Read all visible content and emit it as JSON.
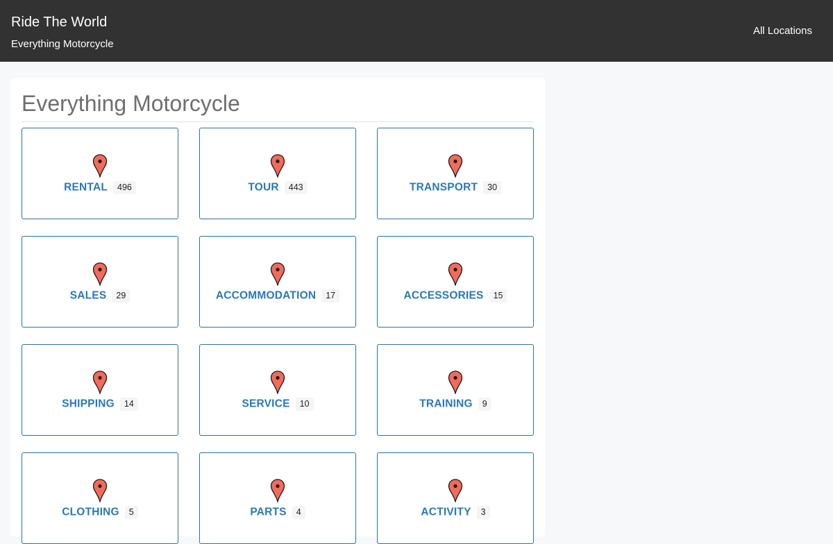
{
  "header": {
    "brand_title": "Ride The World",
    "brand_subtitle": "Everything Motorcycle",
    "nav_link": "All Locations"
  },
  "main": {
    "title": "Everything Motorcycle",
    "categories": [
      {
        "label": "RENTAL",
        "count": "496"
      },
      {
        "label": "TOUR",
        "count": "443"
      },
      {
        "label": "TRANSPORT",
        "count": "30"
      },
      {
        "label": "SALES",
        "count": "29"
      },
      {
        "label": "ACCOMMODATION",
        "count": "17"
      },
      {
        "label": "ACCESSORIES",
        "count": "15"
      },
      {
        "label": "SHIPPING",
        "count": "14"
      },
      {
        "label": "SERVICE",
        "count": "10"
      },
      {
        "label": "TRAINING",
        "count": "9"
      },
      {
        "label": "CLOTHING",
        "count": "5"
      },
      {
        "label": "PARTS",
        "count": "4"
      },
      {
        "label": "ACTIVITY",
        "count": "3"
      }
    ]
  },
  "icons": {
    "category_icon": "map-pin-icon"
  },
  "colors": {
    "header_bg": "#323232",
    "link_blue": "#2a78b4",
    "tile_border": "#2f6fa6",
    "pin_fill": "#f26b5b"
  }
}
